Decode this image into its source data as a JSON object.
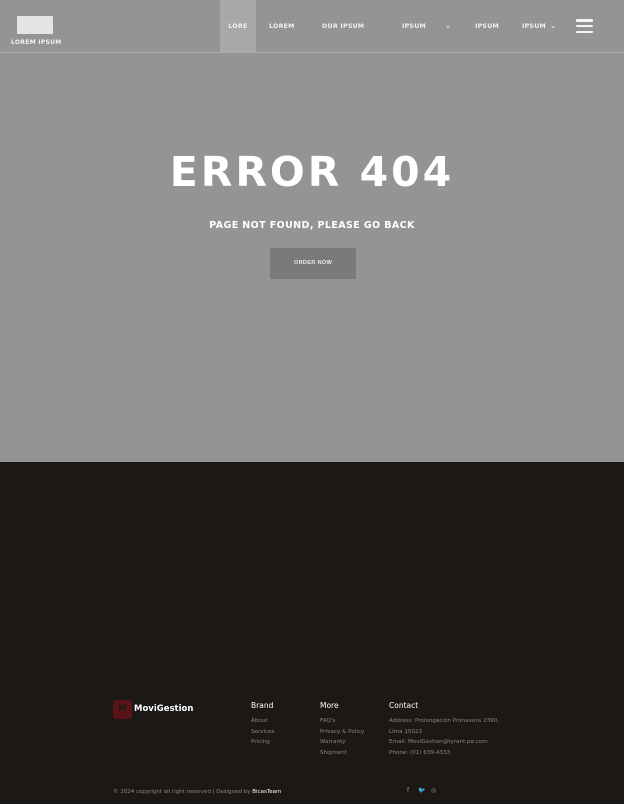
{
  "header": {
    "logo_text": "LOREM IPSUM",
    "nav": [
      {
        "label": "LORE",
        "active": true
      },
      {
        "label": "LOREM"
      },
      {
        "label": "OUR IPSUM"
      },
      {
        "label": "IPSUM",
        "dropdown": true
      },
      {
        "label": "IPSUM"
      },
      {
        "label": "IPSUM",
        "dropdown": true
      }
    ],
    "menu_icon": "hamburger-icon"
  },
  "hero": {
    "title": "ERROR 404",
    "subtitle": "PAGE NOT FOUND, PLEASE GO BACK",
    "button_label": "ORDER NOW"
  },
  "footer": {
    "brand": {
      "logo_letter": "M",
      "name": "MoviGestion"
    },
    "columns": [
      {
        "title": "Brand",
        "items": [
          "About",
          "Services",
          "Pricing"
        ]
      },
      {
        "title": "More",
        "items": [
          "FAQ's",
          "Privacy & Policy",
          "Warranty",
          "Shipment"
        ]
      },
      {
        "title": "Contact",
        "items": [
          "Address: Prolongación Primavera 2390,",
          "Lima 15023",
          "Email: MoviGestion@tyrant.pe.com",
          "Phone: (01) 639-4333"
        ]
      }
    ],
    "copyright": "© 2024 copyright all right reserved | Designed by",
    "designer": "BicasTeam",
    "social": [
      "f",
      "🐦",
      "◎"
    ],
    "social_icons": [
      "facebook-icon",
      "twitter-icon",
      "instagram-icon"
    ]
  },
  "colors": {
    "hero_bg": "#949494",
    "footer_bg": "#1b1816",
    "brand_accent": "#5a1418"
  }
}
